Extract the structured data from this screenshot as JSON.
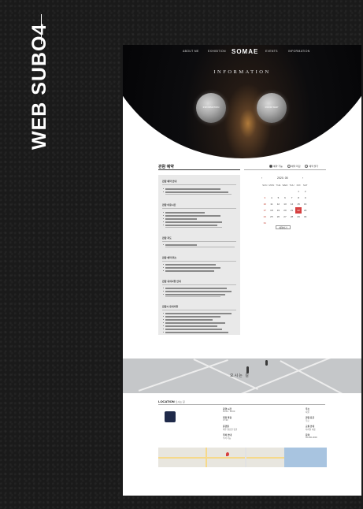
{
  "side": {
    "title": "WEB SUBO4"
  },
  "nav": {
    "items": [
      "ABOUT ME",
      "EXHIBITION",
      "EVENTS",
      "INFORMATION"
    ],
    "logo": "SOMAE"
  },
  "hero": {
    "title": "INFORMATION",
    "moon_left": "INFORMATION",
    "moon_right": "ROOM MAP"
  },
  "content": {
    "title": "관람 예약",
    "legend": [
      "예약 가능",
      "예약 마감",
      "예약 불가"
    ],
    "sections": [
      "관람 예약 안내",
      "관람 이용시간",
      "관람 지도",
      "관람 예약 취소",
      "관람 유의사항 안내",
      "관람시 유의사항"
    ]
  },
  "calendar": {
    "month": "2020. 05",
    "prev": "‹",
    "next": "›",
    "weekdays": [
      "SUN",
      "MON",
      "TUE",
      "WED",
      "THU",
      "FRI",
      "SAT"
    ],
    "weeks": [
      [
        "",
        "",
        "",
        "",
        "",
        "1",
        "2"
      ],
      [
        "3",
        "4",
        "5",
        "6",
        "7",
        "8",
        "9"
      ],
      [
        "10",
        "11",
        "12",
        "13",
        "14",
        "15",
        "16"
      ],
      [
        "17",
        "18",
        "19",
        "20",
        "21",
        "22",
        "23"
      ],
      [
        "24",
        "25",
        "26",
        "27",
        "28",
        "29",
        "30"
      ],
      [
        "31",
        "",
        "",
        "",
        "",
        "",
        ""
      ]
    ],
    "today": "22",
    "button": "예약하기"
  },
  "banner": {
    "text": "오시는 길"
  },
  "location": {
    "title": "LOCATION",
    "subtitle": "오시는 길",
    "fields": [
      {
        "label": "운영 시간",
        "value": "10:00 - 18:00"
      },
      {
        "label": "입장 마감",
        "value": "17:30"
      },
      {
        "label": "휴관일",
        "value": "매주 월요일 휴관"
      },
      {
        "label": "주차 안내",
        "value": "주차 가능"
      },
      {
        "label": "주소",
        "value": "서울"
      },
      {
        "label": "관람 요금",
        "value": "무료"
      },
      {
        "label": "교통 안내",
        "value": "지하철 이용"
      },
      {
        "label": "문의",
        "value": "02-000-0000"
      }
    ]
  }
}
